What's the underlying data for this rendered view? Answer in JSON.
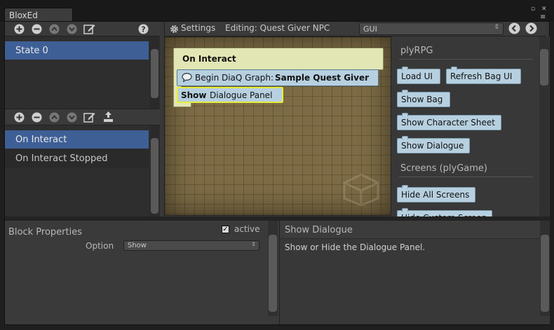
{
  "window": {
    "tab_title": "BloxEd",
    "maximize_icon": "▫",
    "close_icon": "✕",
    "menu_icon": "≡"
  },
  "states": {
    "toolbar_icons": [
      "plus-icon",
      "minus-icon",
      "up-icon",
      "down-icon",
      "edit-icon",
      "help-icon"
    ],
    "items": [
      {
        "label": "State 0",
        "selected": true
      }
    ]
  },
  "events": {
    "toolbar_icons": [
      "plus-icon",
      "minus-icon",
      "up-icon",
      "down-icon",
      "edit-icon",
      "upload-icon"
    ],
    "items": [
      {
        "label": "On Interact",
        "selected": true
      },
      {
        "label": "On Interact Stopped",
        "selected": false
      }
    ]
  },
  "editor_toolbar": {
    "settings_label": "Settings",
    "editing_label": "Editing: Quest Giver NPC",
    "palette_select": "GUI"
  },
  "canvas": {
    "event_block": "On Interact",
    "begin_block": {
      "prefix": "Begin DiaQ Graph:",
      "value": "Sample Quest Giver"
    },
    "show_block": {
      "keyword": "Show",
      "text": "Dialogue Panel"
    }
  },
  "palette": {
    "section1": "plyRPG",
    "section1_blocks": [
      "Load UI",
      "Refresh Bag UI",
      "Show Bag",
      "Show Character Sheet",
      "Show Dialogue"
    ],
    "section2": "Screens (plyGame)",
    "section2_blocks": [
      "Hide All Screens",
      "Hide Custom Screen"
    ]
  },
  "properties": {
    "title": "Block Properties",
    "active_label": "active",
    "active_checked": true,
    "option_label": "Option",
    "option_value": "Show"
  },
  "help": {
    "title": "Show Dialogue",
    "description": "Show or Hide the Dialogue Panel."
  },
  "colors": {
    "selection": "#3e5f96",
    "block_blue": "#b7d0e0",
    "event_block": "#e2e6b4",
    "selected_outline": "#e8ec3a",
    "canvas": "#7c6b45"
  }
}
